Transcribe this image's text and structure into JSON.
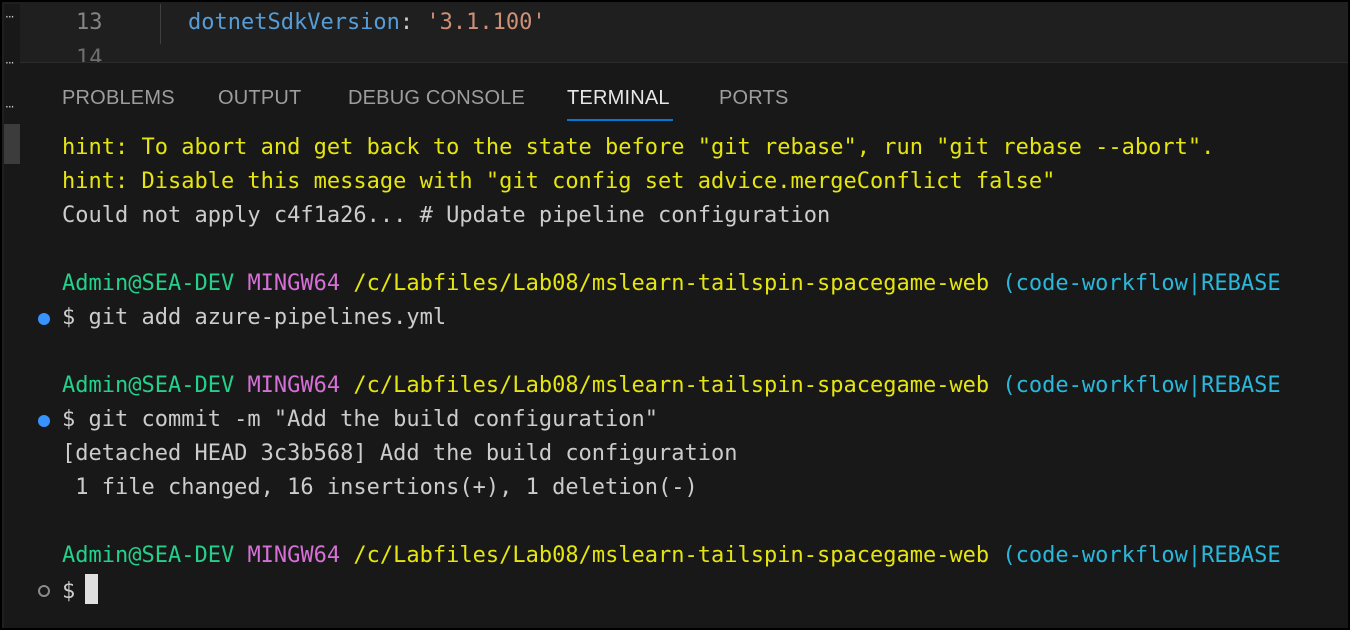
{
  "editor": {
    "line_number": "13",
    "next_line_number": "14",
    "code_key": "dotnetSdkVersion",
    "code_colon": ": ",
    "code_value": "'3.1.100'"
  },
  "panel": {
    "tabs": [
      {
        "label": "PROBLEMS",
        "active": false
      },
      {
        "label": "OUTPUT",
        "active": false
      },
      {
        "label": "DEBUG CONSOLE",
        "active": false
      },
      {
        "label": "TERMINAL",
        "active": true
      },
      {
        "label": "PORTS",
        "active": false
      }
    ]
  },
  "terminal": {
    "hint1": "hint: To abort and get back to the state before \"git rebase\", run \"git rebase --abort\".",
    "hint2": "hint: Disable this message with \"git config set advice.mergeConflict false\"",
    "error_line": "Could not apply c4f1a26... # Update pipeline configuration",
    "prompt": {
      "user_host": "Admin@SEA-DEV",
      "shell": "MINGW64",
      "path": "/c/Labfiles/Lab08/mslearn-tailspin-spacegame-web",
      "branch": "(code-workflow|REBASE"
    },
    "cmd1": "$ git add azure-pipelines.yml",
    "cmd2": "$ git commit -m \"Add the build configuration\"",
    "out1": "[detached HEAD 3c3b568] Add the build configuration",
    "out2": " 1 file changed, 16 insertions(+), 1 deletion(-)",
    "prompt_symbol": "$"
  },
  "colors": {
    "hint": "#e5e510",
    "user_host": "#23d18b",
    "shell": "#d670d6",
    "path": "#e5e510",
    "branch": "#29b8db",
    "active_tab_underline": "#0078d4",
    "decoration_success": "#3794ff"
  }
}
